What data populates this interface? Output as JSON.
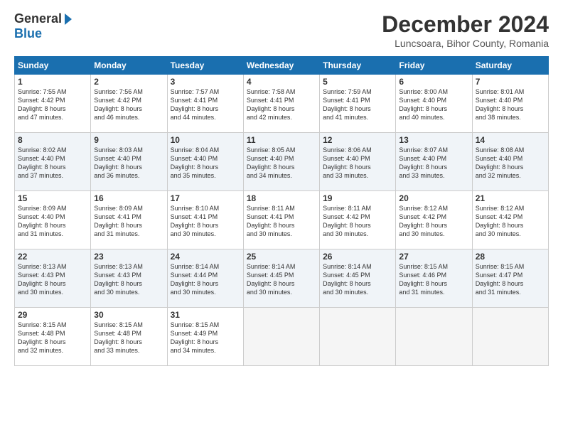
{
  "header": {
    "logo_general": "General",
    "logo_blue": "Blue",
    "title": "December 2024",
    "location": "Luncsoara, Bihor County, Romania"
  },
  "days_of_week": [
    "Sunday",
    "Monday",
    "Tuesday",
    "Wednesday",
    "Thursday",
    "Friday",
    "Saturday"
  ],
  "weeks": [
    [
      {
        "day": "1",
        "info": "Sunrise: 7:55 AM\nSunset: 4:42 PM\nDaylight: 8 hours\nand 47 minutes."
      },
      {
        "day": "2",
        "info": "Sunrise: 7:56 AM\nSunset: 4:42 PM\nDaylight: 8 hours\nand 46 minutes."
      },
      {
        "day": "3",
        "info": "Sunrise: 7:57 AM\nSunset: 4:41 PM\nDaylight: 8 hours\nand 44 minutes."
      },
      {
        "day": "4",
        "info": "Sunrise: 7:58 AM\nSunset: 4:41 PM\nDaylight: 8 hours\nand 42 minutes."
      },
      {
        "day": "5",
        "info": "Sunrise: 7:59 AM\nSunset: 4:41 PM\nDaylight: 8 hours\nand 41 minutes."
      },
      {
        "day": "6",
        "info": "Sunrise: 8:00 AM\nSunset: 4:40 PM\nDaylight: 8 hours\nand 40 minutes."
      },
      {
        "day": "7",
        "info": "Sunrise: 8:01 AM\nSunset: 4:40 PM\nDaylight: 8 hours\nand 38 minutes."
      }
    ],
    [
      {
        "day": "8",
        "info": "Sunrise: 8:02 AM\nSunset: 4:40 PM\nDaylight: 8 hours\nand 37 minutes."
      },
      {
        "day": "9",
        "info": "Sunrise: 8:03 AM\nSunset: 4:40 PM\nDaylight: 8 hours\nand 36 minutes."
      },
      {
        "day": "10",
        "info": "Sunrise: 8:04 AM\nSunset: 4:40 PM\nDaylight: 8 hours\nand 35 minutes."
      },
      {
        "day": "11",
        "info": "Sunrise: 8:05 AM\nSunset: 4:40 PM\nDaylight: 8 hours\nand 34 minutes."
      },
      {
        "day": "12",
        "info": "Sunrise: 8:06 AM\nSunset: 4:40 PM\nDaylight: 8 hours\nand 33 minutes."
      },
      {
        "day": "13",
        "info": "Sunrise: 8:07 AM\nSunset: 4:40 PM\nDaylight: 8 hours\nand 33 minutes."
      },
      {
        "day": "14",
        "info": "Sunrise: 8:08 AM\nSunset: 4:40 PM\nDaylight: 8 hours\nand 32 minutes."
      }
    ],
    [
      {
        "day": "15",
        "info": "Sunrise: 8:09 AM\nSunset: 4:40 PM\nDaylight: 8 hours\nand 31 minutes."
      },
      {
        "day": "16",
        "info": "Sunrise: 8:09 AM\nSunset: 4:41 PM\nDaylight: 8 hours\nand 31 minutes."
      },
      {
        "day": "17",
        "info": "Sunrise: 8:10 AM\nSunset: 4:41 PM\nDaylight: 8 hours\nand 30 minutes."
      },
      {
        "day": "18",
        "info": "Sunrise: 8:11 AM\nSunset: 4:41 PM\nDaylight: 8 hours\nand 30 minutes."
      },
      {
        "day": "19",
        "info": "Sunrise: 8:11 AM\nSunset: 4:42 PM\nDaylight: 8 hours\nand 30 minutes."
      },
      {
        "day": "20",
        "info": "Sunrise: 8:12 AM\nSunset: 4:42 PM\nDaylight: 8 hours\nand 30 minutes."
      },
      {
        "day": "21",
        "info": "Sunrise: 8:12 AM\nSunset: 4:42 PM\nDaylight: 8 hours\nand 30 minutes."
      }
    ],
    [
      {
        "day": "22",
        "info": "Sunrise: 8:13 AM\nSunset: 4:43 PM\nDaylight: 8 hours\nand 30 minutes."
      },
      {
        "day": "23",
        "info": "Sunrise: 8:13 AM\nSunset: 4:43 PM\nDaylight: 8 hours\nand 30 minutes."
      },
      {
        "day": "24",
        "info": "Sunrise: 8:14 AM\nSunset: 4:44 PM\nDaylight: 8 hours\nand 30 minutes."
      },
      {
        "day": "25",
        "info": "Sunrise: 8:14 AM\nSunset: 4:45 PM\nDaylight: 8 hours\nand 30 minutes."
      },
      {
        "day": "26",
        "info": "Sunrise: 8:14 AM\nSunset: 4:45 PM\nDaylight: 8 hours\nand 30 minutes."
      },
      {
        "day": "27",
        "info": "Sunrise: 8:15 AM\nSunset: 4:46 PM\nDaylight: 8 hours\nand 31 minutes."
      },
      {
        "day": "28",
        "info": "Sunrise: 8:15 AM\nSunset: 4:47 PM\nDaylight: 8 hours\nand 31 minutes."
      }
    ],
    [
      {
        "day": "29",
        "info": "Sunrise: 8:15 AM\nSunset: 4:48 PM\nDaylight: 8 hours\nand 32 minutes."
      },
      {
        "day": "30",
        "info": "Sunrise: 8:15 AM\nSunset: 4:48 PM\nDaylight: 8 hours\nand 33 minutes."
      },
      {
        "day": "31",
        "info": "Sunrise: 8:15 AM\nSunset: 4:49 PM\nDaylight: 8 hours\nand 34 minutes."
      },
      {
        "day": "",
        "info": ""
      },
      {
        "day": "",
        "info": ""
      },
      {
        "day": "",
        "info": ""
      },
      {
        "day": "",
        "info": ""
      }
    ]
  ]
}
